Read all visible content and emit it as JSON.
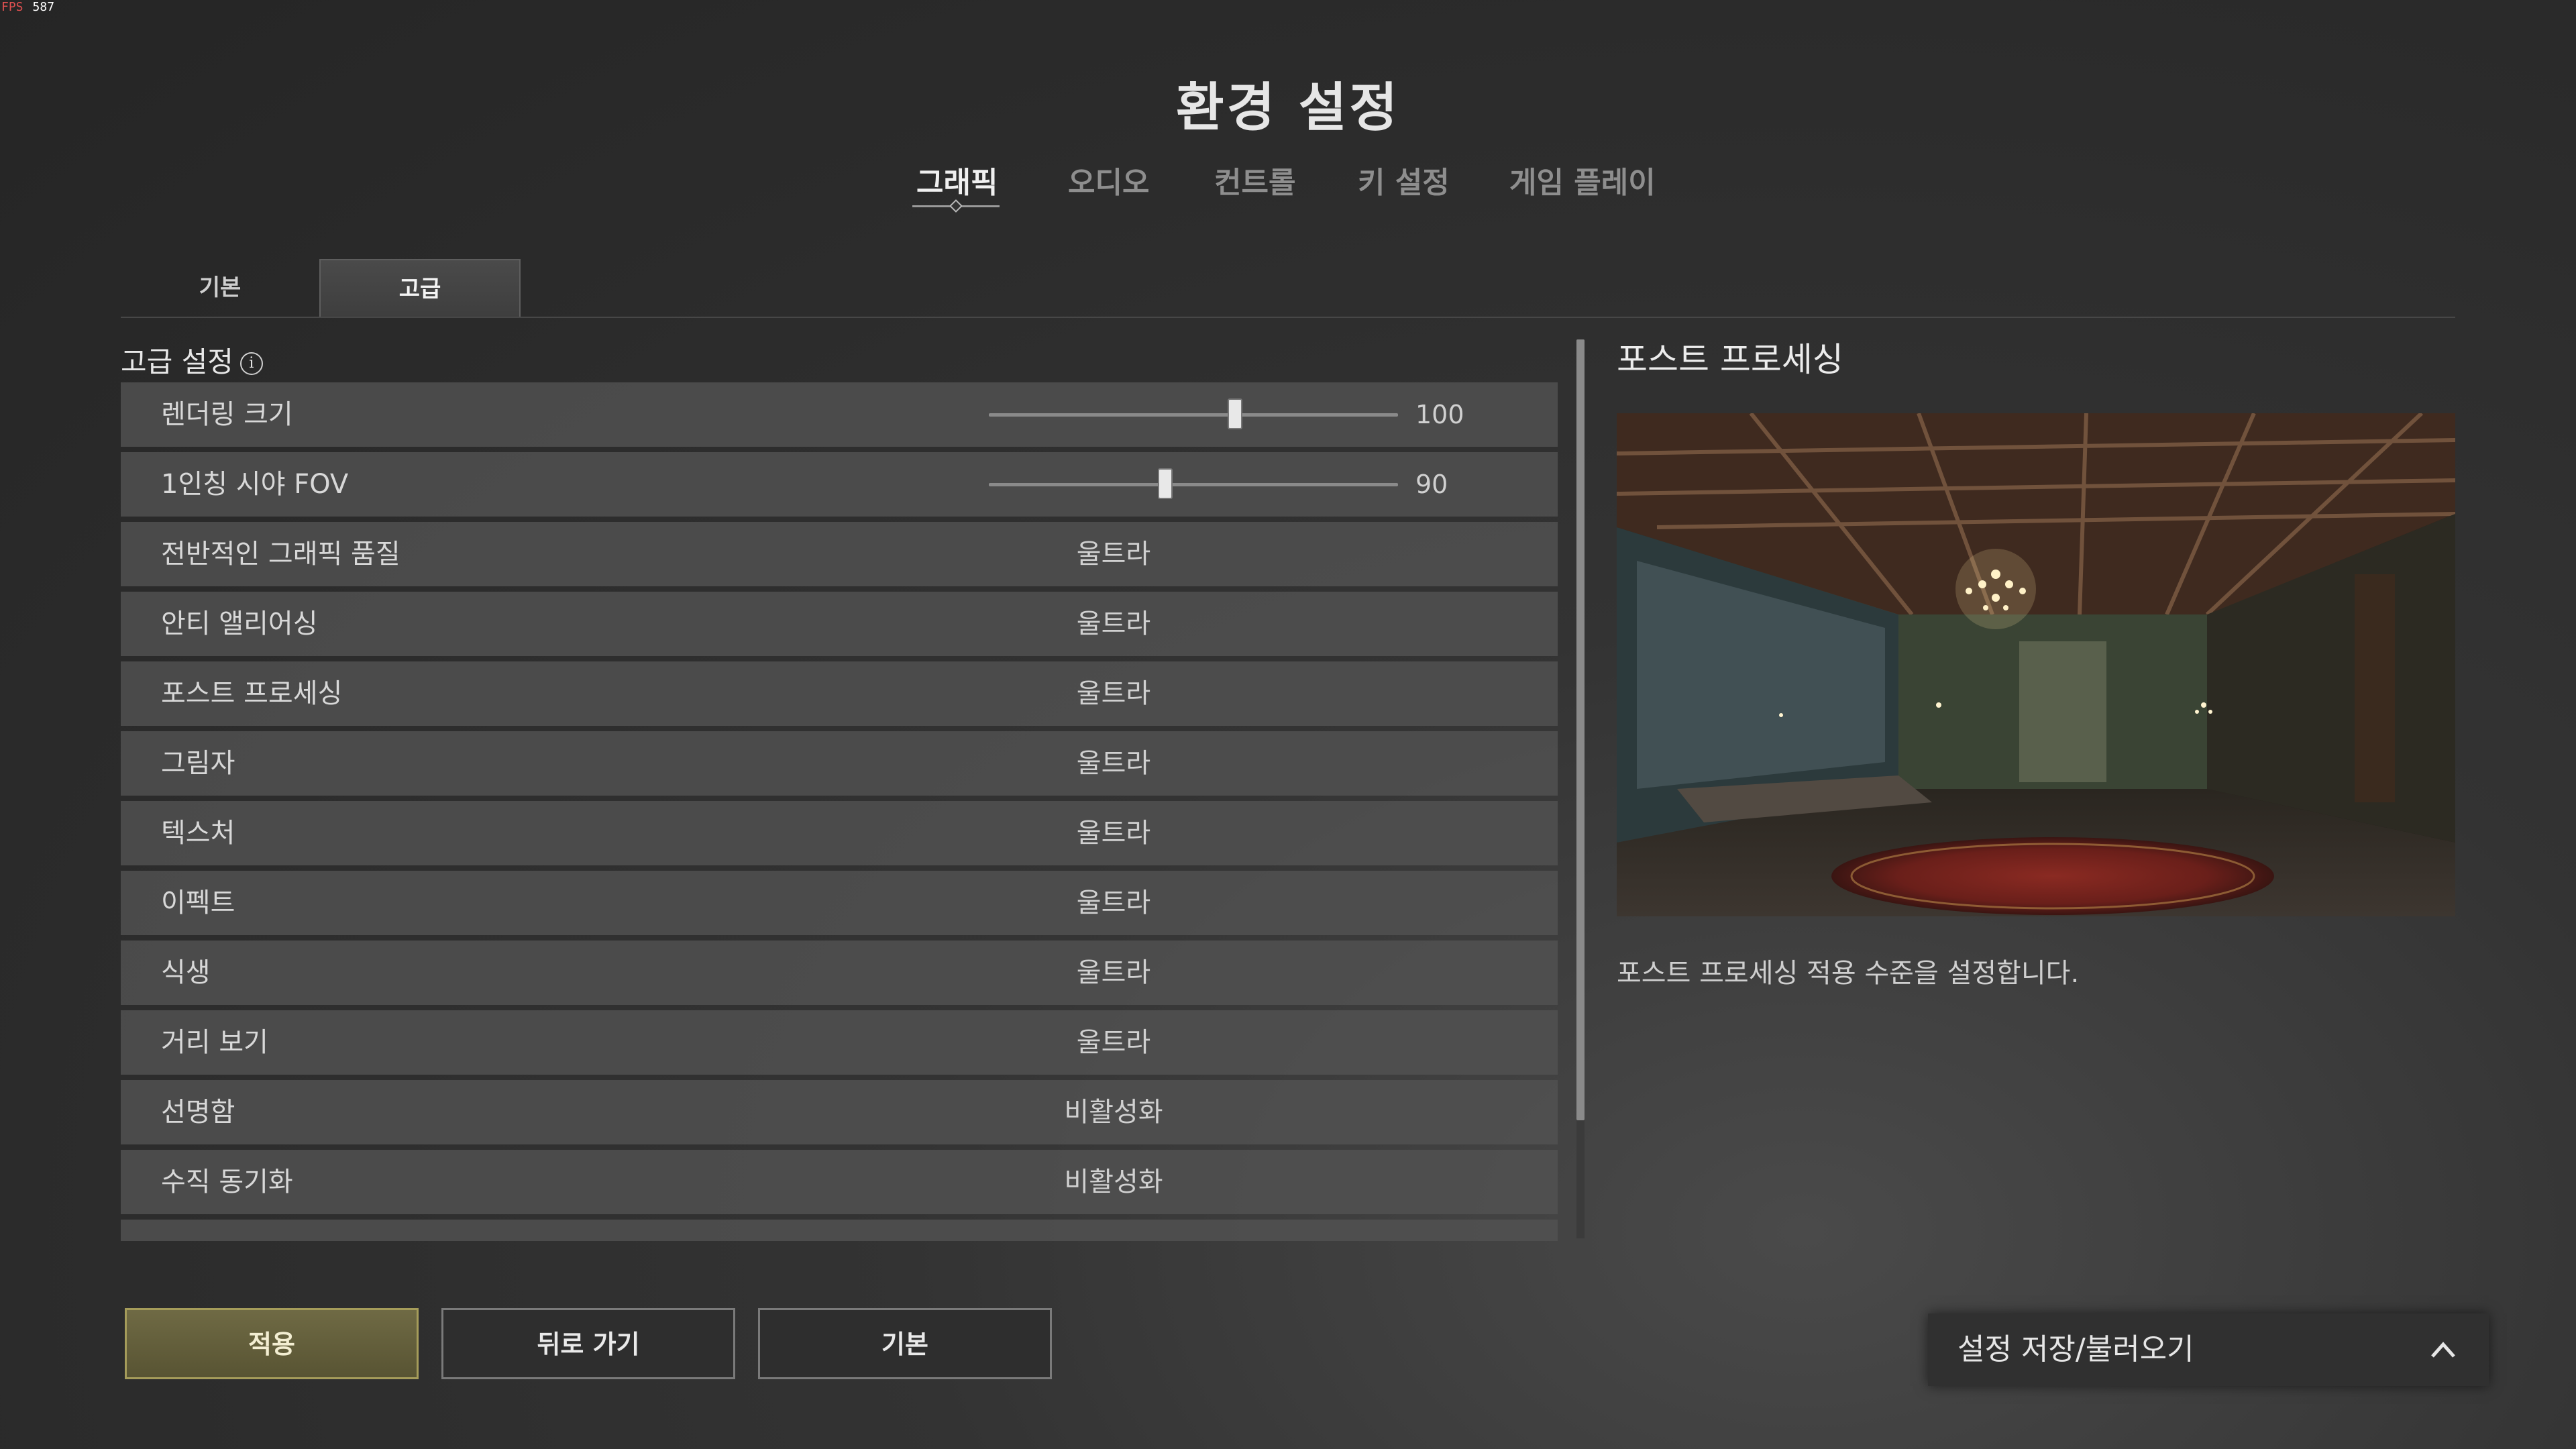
{
  "fps": {
    "label": "FPS",
    "value": "587"
  },
  "title": "환경 설정",
  "tabs": [
    {
      "label": "그래픽",
      "active": true
    },
    {
      "label": "오디오"
    },
    {
      "label": "컨트롤"
    },
    {
      "label": "키 설정"
    },
    {
      "label": "게임 플레이"
    }
  ],
  "subtabs": [
    {
      "label": "기본"
    },
    {
      "label": "고급",
      "active": true
    }
  ],
  "section": {
    "title": "고급 설정",
    "info_icon": "i"
  },
  "settings": [
    {
      "label": "렌더링 크기",
      "type": "slider",
      "value": "100",
      "fraction": 0.6
    },
    {
      "label": "1인칭 시야 FOV",
      "type": "slider",
      "value": "90",
      "fraction": 0.43
    },
    {
      "label": "전반적인 그래픽 품질",
      "value": "울트라"
    },
    {
      "label": "안티 앨리어싱",
      "value": "울트라"
    },
    {
      "label": "포스트 프로세싱",
      "value": "울트라"
    },
    {
      "label": "그림자",
      "value": "울트라"
    },
    {
      "label": "텍스처",
      "value": "울트라"
    },
    {
      "label": "이펙트",
      "value": "울트라"
    },
    {
      "label": "식생",
      "value": "울트라"
    },
    {
      "label": "거리 보기",
      "value": "울트라"
    },
    {
      "label": "선명함",
      "value": "비활성화"
    },
    {
      "label": "수직 동기화",
      "value": "비활성화"
    },
    {
      "label": "",
      "value": ""
    }
  ],
  "scroll": {
    "fraction": 0.87
  },
  "preview": {
    "title": "포스트 프로세싱",
    "description": "포스트 프로세싱 적용 수준을 설정합니다."
  },
  "buttons": {
    "apply": "적용",
    "back": "뒤로 가기",
    "default": "기본"
  },
  "preset": {
    "label": "설정 저장/불러오기",
    "icon": "chevron-up-icon"
  },
  "colors": {
    "accent": "#6f6a44",
    "accent_border": "#a59c5a",
    "row_bg": "#525252"
  }
}
